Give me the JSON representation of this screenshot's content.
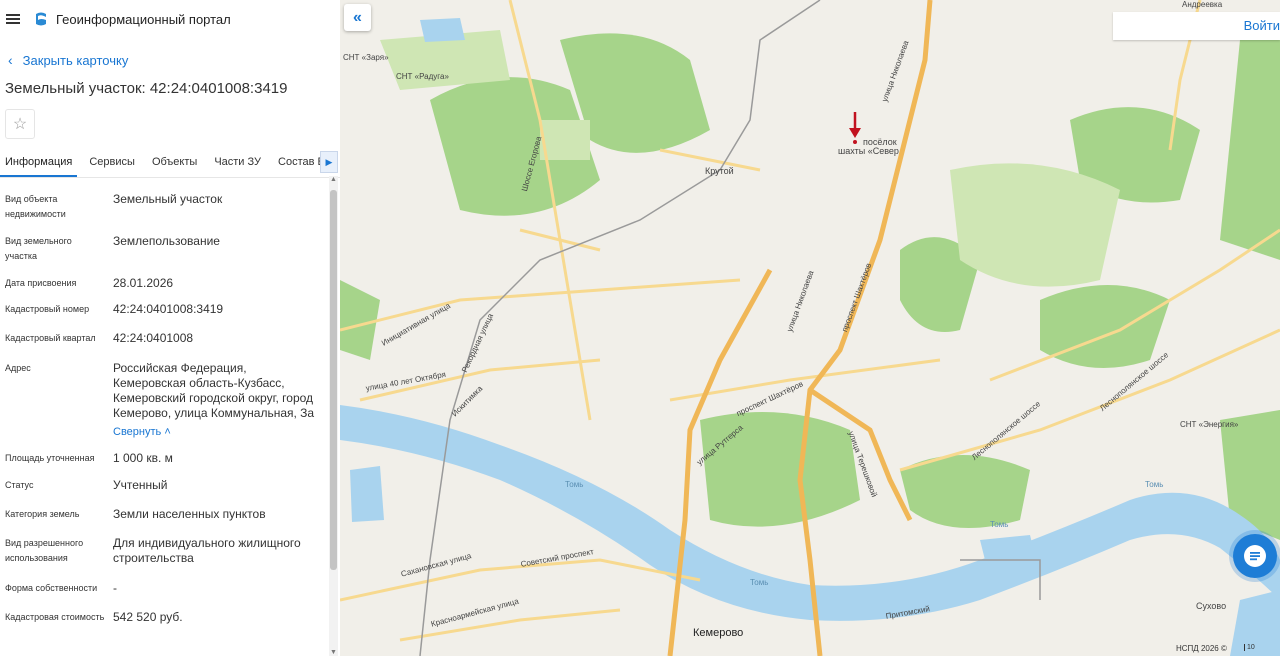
{
  "header": {
    "app_title": "Геоинформационный портал"
  },
  "card": {
    "close_label": "Закрыть карточку",
    "title": "Земельный участок: 42:24:0401008:3419",
    "tabs": [
      "Информация",
      "Сервисы",
      "Объекты",
      "Части ЗУ",
      "Состав Е"
    ],
    "active_tab": "Информация",
    "collapse_label": "Свернуть",
    "rows": [
      {
        "label": "Вид объекта недвижимости",
        "value": "Земельный участок"
      },
      {
        "label": "Вид земельного участка",
        "value": "Землепользование"
      },
      {
        "label": "Дата присвоения",
        "value": "28.01.2026"
      },
      {
        "label": "Кадастровый номер",
        "value": "42:24:0401008:3419"
      },
      {
        "label": "Кадастровый квартал",
        "value": "42:24:0401008"
      },
      {
        "label": "Адрес",
        "value": "Российская Федерация, Кемеровская область-Кузбасс, Кемеровский городской округ, город Кемерово, улица Коммунальная, За"
      },
      {
        "label": "Площадь уточненная",
        "value": "1 000 кв. м"
      },
      {
        "label": "Статус",
        "value": "Учтенный"
      },
      {
        "label": "Категория земель",
        "value": "Земли населенных пунктов"
      },
      {
        "label": "Вид разрешенного использования",
        "value": "Для индивидуального жилищного строительства"
      },
      {
        "label": "Форма собственности",
        "value": "-"
      },
      {
        "label": "Кадастровая стоимость",
        "value": "542 520 руб."
      }
    ]
  },
  "map": {
    "login_label": "Войти",
    "copyright": "НСПД 2026 ©",
    "scale_label": "10",
    "labels": {
      "snt_zarya": "СНТ «Заря»",
      "snt_raduga": "СНТ «Радуга»",
      "andreevka": "Андреевка",
      "poselok": "посёлок",
      "shakhty": "шахты «Север",
      "krutoy": "Крутой",
      "shosse_egorova": "Шоссе Егорова",
      "nikolaeva": "улица Николаева",
      "pr_shakhterov": "проспект Шахтёров",
      "inicziativnaya": "Инициативная улица",
      "rekordnaya": "Рекордная улица",
      "ul_40_let": "улица 40 лет Октября",
      "iskitimka": "Искитимка",
      "ul_rutgersa": "улица Рутгерса",
      "tereshkovoy": "улица Терешковой",
      "lesnopolyanskoe": "Леснополянское шоссе",
      "snt_energiya": "СНТ «Энергия»",
      "tom": "Томь",
      "sovetskiy": "Советский проспект",
      "sakhanovskaya": "Сахановская улица",
      "krasnoarmeyskaya": "Красноармейская улица",
      "kemerovo": "Кемерово",
      "suhovo": "Сухово",
      "pritomskiy": "Притомский"
    },
    "colors": {
      "water": "#a9d3ee",
      "forest": "#9fd17f",
      "major_road": "#f0b757",
      "minor_road": "#f7d98f",
      "marker": "#c1121f",
      "accent": "#1976d2"
    }
  }
}
